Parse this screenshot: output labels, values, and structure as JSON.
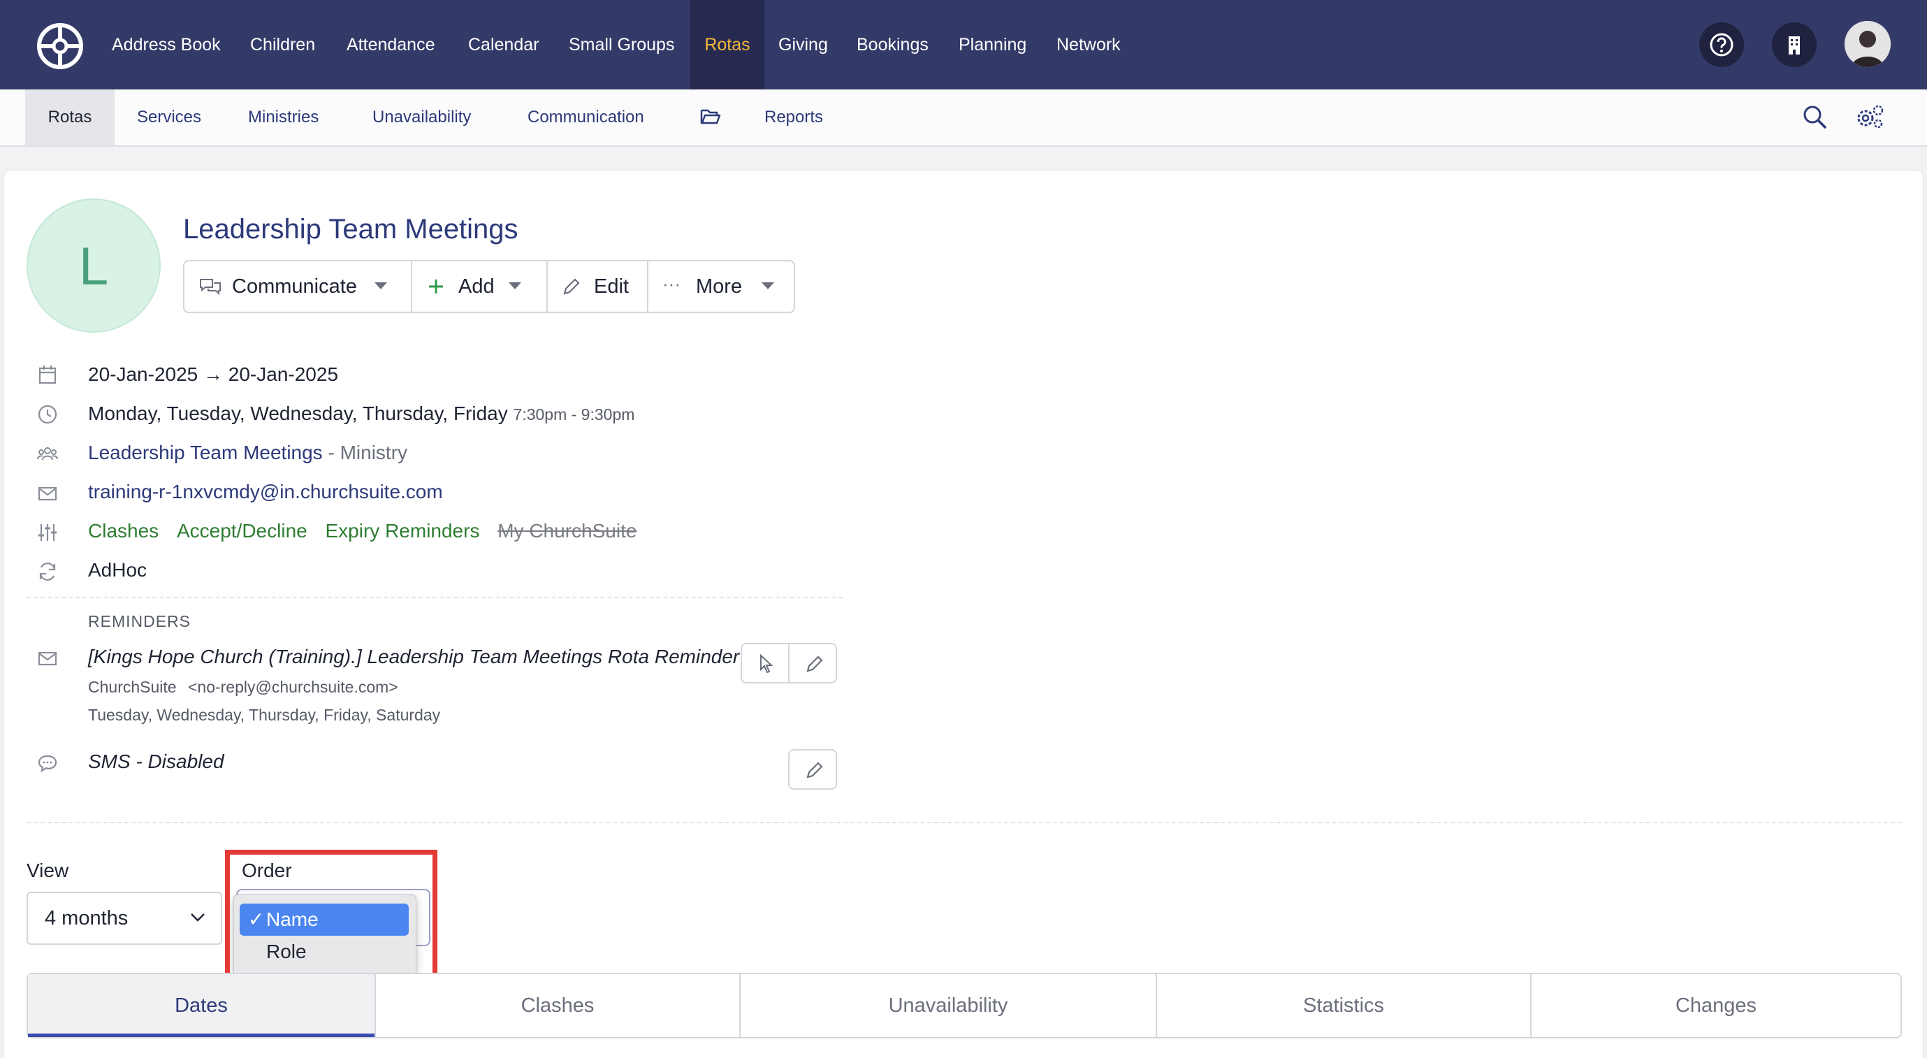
{
  "top_nav": {
    "items": [
      "Address Book",
      "Children",
      "Attendance",
      "Calendar",
      "Small Groups",
      "Rotas",
      "Giving",
      "Bookings",
      "Planning",
      "Network"
    ],
    "active": "Rotas"
  },
  "sub_nav": {
    "items": [
      "Rotas",
      "Services",
      "Ministries",
      "Unavailability",
      "Communication",
      "Reports"
    ],
    "active": "Rotas"
  },
  "rota": {
    "initial": "L",
    "title": "Leadership Team Meetings",
    "actions": {
      "communicate": "Communicate",
      "add": "Add",
      "edit": "Edit",
      "more": "More"
    },
    "date_range": "20-Jan-2025 → 20-Jan-2025",
    "days": "Monday, Tuesday, Wednesday, Thursday, Friday",
    "time": "7:30pm - 9:30pm",
    "ministry_name": "Leadership Team Meetings",
    "ministry_suffix": " - Ministry",
    "email": "training-r-1nxvcmdy@in.churchsuite.com",
    "settings": {
      "clashes": "Clashes",
      "accept_decline": "Accept/Decline",
      "expiry_reminders": "Expiry Reminders",
      "my_churchsuite": "My ChurchSuite"
    },
    "frequency": "AdHoc"
  },
  "reminders": {
    "heading": "REMINDERS",
    "email_subject": "[Kings Hope Church (Training).] Leadership Team Meetings Rota Reminder",
    "email_from_name": "ChurchSuite",
    "email_from_address": "<no-reply@churchsuite.com>",
    "email_days": "Tuesday, Wednesday, Thursday, Friday, Saturday",
    "sms": "SMS - Disabled"
  },
  "view": {
    "label": "View",
    "value": "4 months"
  },
  "order": {
    "label": "Order",
    "options": [
      "Name",
      "Role"
    ],
    "selected": "Name"
  },
  "tabs": [
    "Dates",
    "Clashes",
    "Unavailability",
    "Statistics",
    "Changes"
  ],
  "active_tab": "Dates",
  "colors": {
    "nav_bg": "#343a68",
    "active_nav": "#f5b93a",
    "link": "#2d3a7a",
    "green": "#2e7d32",
    "highlight": "#e53935"
  }
}
